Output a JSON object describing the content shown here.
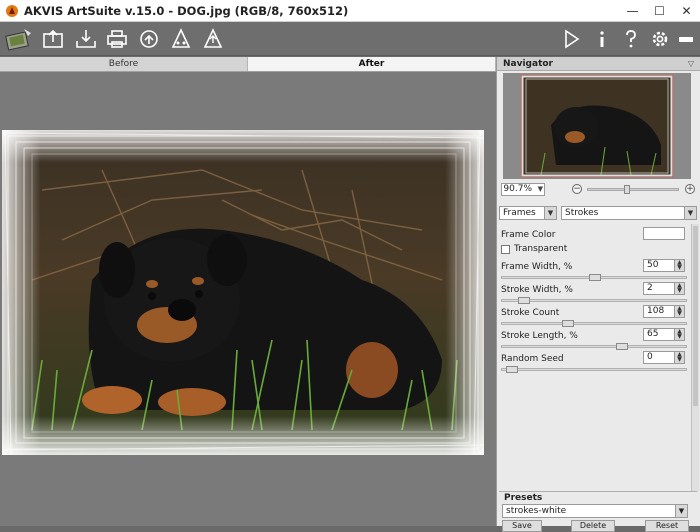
{
  "window": {
    "title": "AKVIS ArtSuite v.15.0 - DOG.jpg (RGB/8, 760x512)",
    "controls": {
      "minimize": "—",
      "maximize": "☐",
      "close": "✕"
    }
  },
  "toolbar": {
    "left_icons": [
      "artsuite-logo-icon",
      "open-icon",
      "save-icon",
      "print-icon",
      "share-icon",
      "batch-icon",
      "upload-icon"
    ],
    "right_icons": [
      "run-icon",
      "info-icon",
      "help-icon",
      "settings-icon",
      "minimize-panel-icon"
    ]
  },
  "tabs": [
    {
      "label": "Before",
      "active": false
    },
    {
      "label": "After",
      "active": true
    }
  ],
  "navigator": {
    "title": "Navigator",
    "zoom": "90.7%",
    "zoom_out": "−",
    "zoom_in": "+"
  },
  "effect": {
    "category": "Frames",
    "type": "Strokes"
  },
  "params": {
    "frame_color_label": "Frame Color",
    "transparent_label": "Transparent",
    "frame_color": "#ffffff",
    "frame_width": {
      "label": "Frame Width, %",
      "value": "50"
    },
    "stroke_width": {
      "label": "Stroke Width, %",
      "value": "2"
    },
    "stroke_count": {
      "label": "Stroke Count",
      "value": "108"
    },
    "stroke_length": {
      "label": "Stroke Length, %",
      "value": "65"
    },
    "random_seed": {
      "label": "Random Seed",
      "value": "0"
    }
  },
  "presets": {
    "title": "Presets",
    "selected": "strokes-white",
    "save": "Save",
    "delete": "Delete",
    "reset": "Reset"
  },
  "colors": {
    "toolbar_bg": "#6e6e6e",
    "canvas_bg": "#7a7a7a",
    "panel_bg": "#eaeaea"
  }
}
